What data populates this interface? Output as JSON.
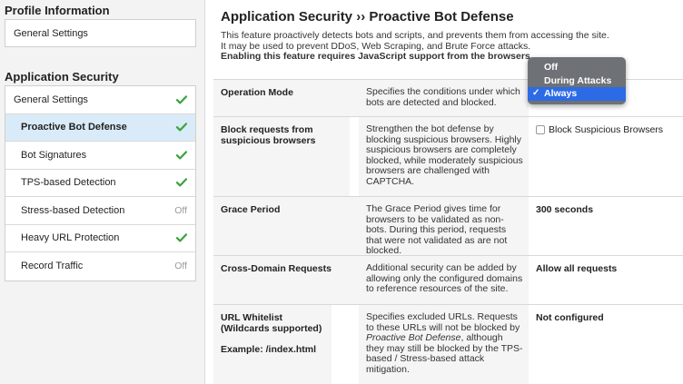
{
  "sidebar": {
    "profile_heading": "Profile Information",
    "profile_items": [
      {
        "label": "General Settings"
      }
    ],
    "appsec_heading": "Application Security",
    "appsec_items": [
      {
        "label": "General Settings",
        "status": "check"
      },
      {
        "label": "Proactive Bot Defense",
        "status": "check",
        "active": true
      },
      {
        "label": "Bot Signatures",
        "status": "check"
      },
      {
        "label": "TPS-based Detection",
        "status": "check"
      },
      {
        "label": "Stress-based Detection",
        "status": "Off"
      },
      {
        "label": "Heavy URL Protection",
        "status": "check"
      },
      {
        "label": "Record Traffic",
        "status": "Off"
      }
    ]
  },
  "main": {
    "title": "Application Security ›› Proactive Bot Defense",
    "desc_line1": "This feature proactively detects bots and scripts, and prevents them from accessing the site.",
    "desc_line2": "It may be used to prevent DDoS, Web Scraping, and Brute Force attacks.",
    "desc_line3": "Enabling this feature requires JavaScript support from the browsers.",
    "rows": [
      {
        "name": "Operation Mode",
        "description": "Specifies the conditions under which bots are detected and blocked.",
        "value": ""
      },
      {
        "name": "Block requests from suspicious browsers",
        "description": "Strengthen the bot defense by blocking suspicious browsers. Highly suspicious browsers are completely blocked, while moderately suspicious browsers are challenged with CAPTCHA.",
        "value": "Block Suspicious Browsers"
      },
      {
        "name": "Grace Period",
        "description": "The Grace Period gives time for browsers to be validated as non-bots. During this period, requests that were not validated as are not blocked.",
        "value": "300 seconds"
      },
      {
        "name": "Cross-Domain Requests",
        "description": "Additional security can be added by allowing only the configured domains to reference resources of the site.",
        "value": "Allow all requests"
      },
      {
        "name": "URL Whitelist (Wildcards supported)",
        "example": "Example: /index.html",
        "description_pre": "Specifies excluded URLs. Requests to these URLs will not be blocked by",
        "description_em": "Proactive Bot Defense",
        "description_post": ", although they may still be blocked by the TPS-based / Stress-based attack mitigation.",
        "value": "Not configured"
      }
    ]
  },
  "dropdown": {
    "options": [
      "Off",
      "During Attacks",
      "Always"
    ],
    "selected": "Always",
    "selected_color": "#2c6be5"
  },
  "colors": {
    "check": "#3aa33a",
    "active_bg": "#d9ebf8"
  }
}
